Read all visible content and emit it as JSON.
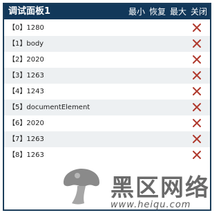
{
  "panel": {
    "title": "调试面板1",
    "controls": {
      "minimize": "最小",
      "restore": "恢复",
      "maximize": "最大",
      "close": "关闭"
    }
  },
  "rows": [
    {
      "label": "【0】1280"
    },
    {
      "label": "【1】body"
    },
    {
      "label": "【2】2020"
    },
    {
      "label": "【3】1263"
    },
    {
      "label": "【4】1243"
    },
    {
      "label": "【5】documentElement"
    },
    {
      "label": "【6】2020"
    },
    {
      "label": "【7】1263"
    },
    {
      "label": "【8】1263"
    }
  ],
  "icons": {
    "row_close": "close-x-icon",
    "watermark_logo": "mushroom-logo"
  },
  "watermark": {
    "name": "黑区网络",
    "url": "www.heiqu.com"
  },
  "colors": {
    "titlebar": "#12385a",
    "row_alt": "#edf0f2",
    "close_x": "#b03a2e"
  }
}
